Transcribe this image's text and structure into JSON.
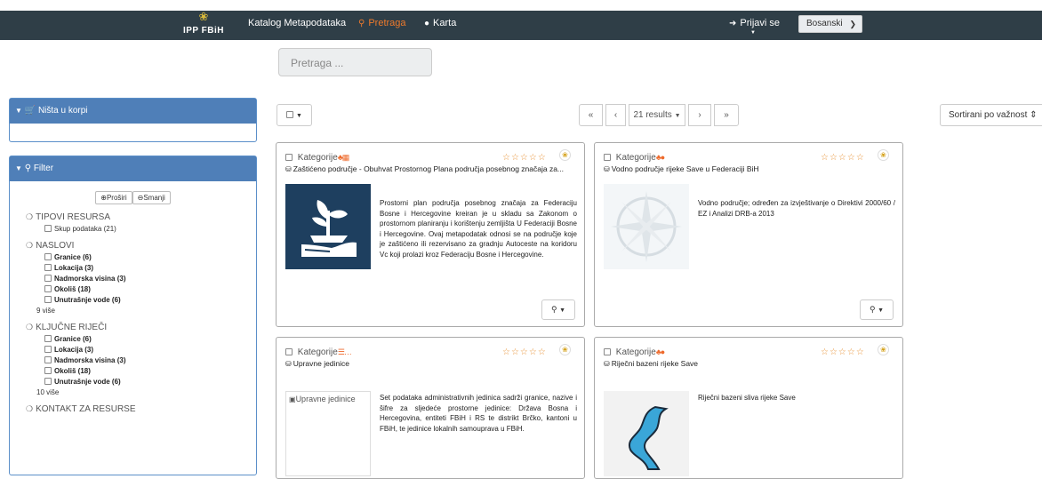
{
  "topbar": {
    "brand": "IPP FBiH",
    "nav": [
      {
        "label": "Katalog Metapodataka",
        "icon": ""
      },
      {
        "label": "Pretraga",
        "icon": "search-icon",
        "active": true
      },
      {
        "label": "Karta",
        "icon": "globe-icon"
      }
    ],
    "login_label": "Prijavi se",
    "language": "Bosanski"
  },
  "search": {
    "placeholder": "Pretraga ..."
  },
  "cart": {
    "title": "Ništa u korpi"
  },
  "filter": {
    "title": "Filter",
    "expand_label": "Proširi",
    "collapse_label": "Smanji",
    "sections": [
      {
        "title": "TIPOVI RESURSA",
        "items": [
          "Skup podataka (21)"
        ],
        "more": ""
      },
      {
        "title": "NASLOVI",
        "items": [
          "Granice (6)",
          "Lokacija (3)",
          "Nadmorska visina (3)",
          "Okoliš (18)",
          "Unutrašnje vode (6)"
        ],
        "more": "9 više"
      },
      {
        "title": "KLJUČNE RIJEČI",
        "items": [
          "Granice (6)",
          "Lokacija (3)",
          "Nadmorska visina (3)",
          "Okoliš (18)",
          "Unutrašnje vode (6)"
        ],
        "more": "10 više"
      },
      {
        "title": "KONTAKT ZA RESURSE",
        "items": [],
        "more": ""
      }
    ]
  },
  "toolbar": {
    "results_label": "21 results",
    "sort_label": "Sortirani po važnost"
  },
  "cards": [
    {
      "category_label": "Kategorije",
      "title": "Zaštićeno područje - Obuhvat Prostornog Plana područja posebnog značaja za...",
      "description": "Prostorni plan područja posebnog značaja za Federaciju Bosne i Hercegovine kreiran je u skladu sa Zakonom o prostornom planiranju i korištenju zemljišta U Federaciji Bosne i Hercegovine. Ovaj metapodatak odnosi se na područje koje je zaštićeno ili rezervisano za gradnju Autoceste na koridoru Vc koji prolazi kroz Federaciju Bosne i Hercegovine.",
      "thumb_alt": ""
    },
    {
      "category_label": "Kategorije",
      "title": "Vodno područje rijeke Save u Federaciji BiH",
      "description": "Vodno područje; određen za izvještivanje o Direktivi 2000/60 / EZ i Analizi DRB-a 2013",
      "thumb_alt": ""
    },
    {
      "category_label": "Kategorije",
      "title": "Upravne jedinice",
      "description": "Set podataka administrativnih jedinica sadrži granice, nazive i šifre za sljedeće prostorne jedinice: Država Bosna i Hercegovina, entiteti FBiH i RS te distrikt Brčko, kantoni u FBiH, te jedinice lokalnih samouprava u FBiH.",
      "thumb_alt": "Upravne jedinice"
    },
    {
      "category_label": "Kategorije",
      "title": "Riječni bazeni rijeke Save",
      "description": "Riječni bazeni sliva rijeke Save",
      "thumb_alt": ""
    }
  ],
  "colors": {
    "topbar": "#2f3e47",
    "accent": "#ee7a2c",
    "panel_header": "#4f7fb8",
    "stars": "#e89338"
  }
}
